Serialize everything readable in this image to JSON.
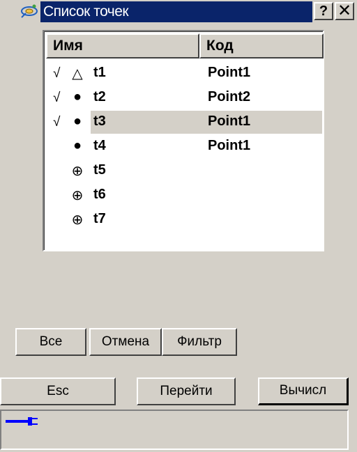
{
  "window": {
    "title": "Список точек",
    "help_glyph": "?",
    "close_glyph": "✕",
    "app_icon": "satellite-icon"
  },
  "list": {
    "columns": [
      "Имя",
      "Код"
    ],
    "rows": [
      {
        "check": "√",
        "symbol": "△",
        "symbol_name": "triangle-point-icon",
        "name": "t1",
        "code": "Point1",
        "selected": false
      },
      {
        "check": "√",
        "symbol": "●",
        "symbol_name": "dot-point-icon",
        "name": "t2",
        "code": "Point2",
        "selected": false
      },
      {
        "check": "√",
        "symbol": "●",
        "symbol_name": "dot-point-icon",
        "name": "t3",
        "code": "Point1",
        "selected": true
      },
      {
        "check": "",
        "symbol": "●",
        "symbol_name": "dot-point-icon",
        "name": "t4",
        "code": "Point1",
        "selected": false
      },
      {
        "check": "",
        "symbol": "⊕",
        "symbol_name": "crosshair-point-icon",
        "name": "t5",
        "code": "",
        "selected": false
      },
      {
        "check": "",
        "symbol": "⊕",
        "symbol_name": "crosshair-point-icon",
        "name": "t6",
        "code": "",
        "selected": false
      },
      {
        "check": "",
        "symbol": "⊕",
        "symbol_name": "crosshair-point-icon",
        "name": "t7",
        "code": "",
        "selected": false
      }
    ]
  },
  "buttons": {
    "all": "Все",
    "cancel": "Отмена",
    "filter": "Фильтр",
    "esc": "Esc",
    "goto": "Перейти",
    "calc": "Вычисл"
  },
  "status": {
    "icon": "plug-connection-icon",
    "color": "#0000ff"
  },
  "colors": {
    "titlebar": "#0a246a",
    "face": "#d4d0c8",
    "selection": "#d4d0c8"
  }
}
